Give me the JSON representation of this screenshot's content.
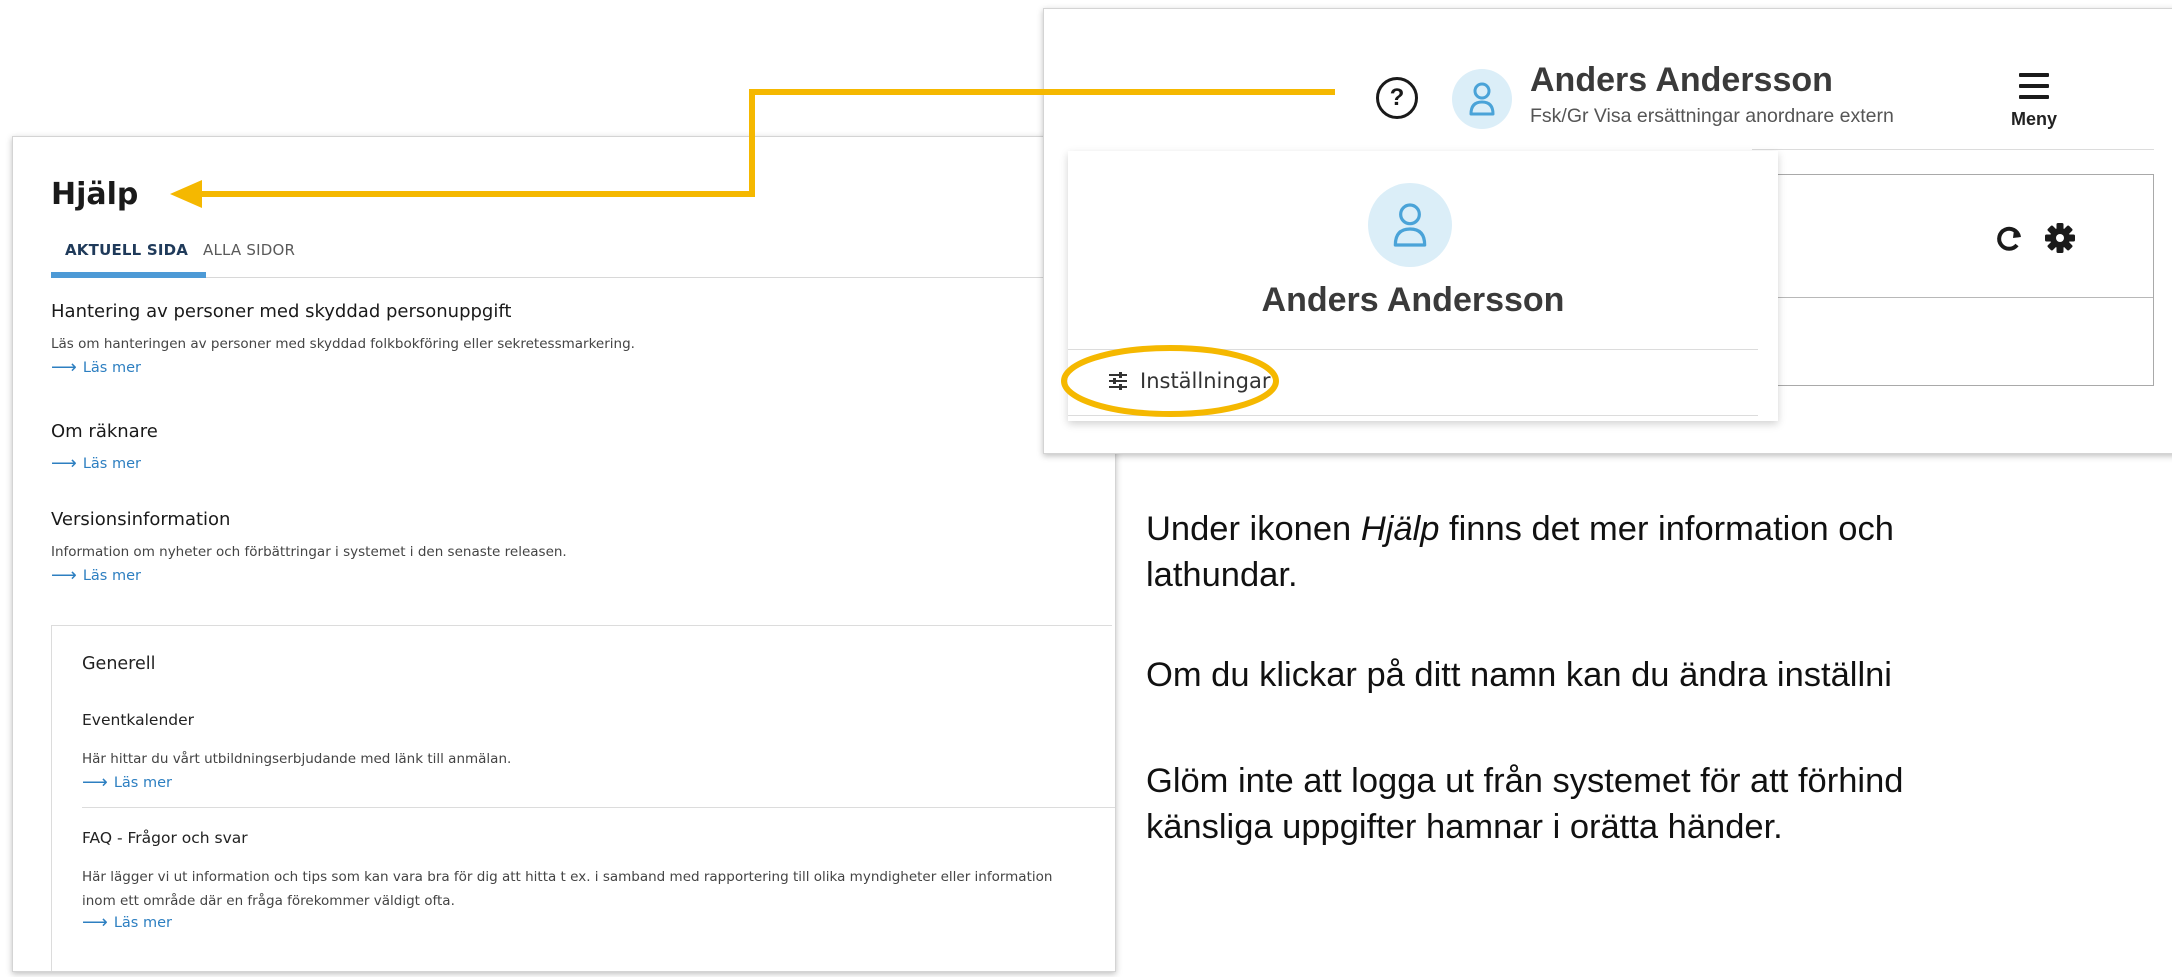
{
  "help": {
    "title": "Hjälp",
    "tabs": [
      {
        "label": "AKTUELL SIDA"
      },
      {
        "label": "ALLA SIDOR"
      }
    ],
    "sections": [
      {
        "title": "Hantering av personer med skyddad personuppgift",
        "desc": "Läs om hanteringen av personer med skyddad folkbokföring eller sekretessmarkering.",
        "link": "Läs mer"
      },
      {
        "title": "Om räknare",
        "desc": "",
        "link": "Läs mer"
      },
      {
        "title": "Versionsinformation",
        "desc": "Information om nyheter och förbättringar i systemet i den senaste releasen.",
        "link": "Läs mer"
      }
    ],
    "general": {
      "title": "Generell",
      "items": [
        {
          "title": "Eventkalender",
          "desc": "Här hittar du vårt utbildningserbjudande med länk till anmälan.",
          "link": "Läs mer"
        },
        {
          "title": "FAQ - Frågor och svar",
          "desc": "Här lägger vi ut information och tips som kan vara bra för dig att hitta t ex. i samband med rapportering till olika myndigheter eller information inom ett område där en fråga förekommer väldigt ofta.",
          "link": "Läs mer"
        }
      ]
    }
  },
  "header": {
    "help_icon_glyph": "?",
    "user_name": "Anders Andersson",
    "user_role": "Fsk/Gr Visa ersättningar anordnare extern",
    "menu_label": "Meny"
  },
  "dropdown": {
    "name": "Anders Andersson",
    "settings_label": "Inställningar"
  },
  "body": {
    "p1_before": "Under ikonen ",
    "p1_em": "Hjälp",
    "p1_after": " finns det mer information och",
    "p1_line2": "lathundar.",
    "p2": "Om du klickar på ditt namn kan du ändra inställni",
    "p3_line1": "Glöm inte att logga ut från systemet för att förhind",
    "p3_line2": "känsliga uppgifter hamnar i orätta händer."
  },
  "colors": {
    "annotation": "#f5b800",
    "link": "#2d7fc1",
    "tab_underline": "#4d9ad6",
    "avatar_bg": "#dbeef8",
    "avatar_fg": "#4aa3d8"
  },
  "icons": [
    "help-icon",
    "user-icon",
    "hamburger-icon",
    "refresh-icon",
    "gear-icon",
    "sliders-icon",
    "arrow-right-icon"
  ]
}
